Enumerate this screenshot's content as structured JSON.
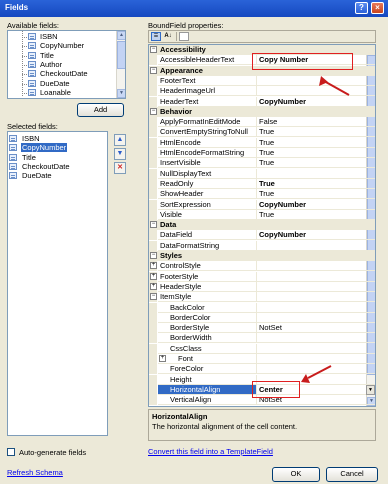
{
  "window": {
    "title": "Fields",
    "help": "?",
    "close": "×"
  },
  "available": {
    "label": "Available fields:",
    "items": [
      "ISBN",
      "CopyNumber",
      "Title",
      "Author",
      "CheckoutDate",
      "DueDate",
      "Loanable"
    ],
    "add_label": "Add"
  },
  "selected": {
    "label": "Selected fields:",
    "items": [
      "ISBN",
      "CopyNumber",
      "Title",
      "CheckoutDate",
      "DueDate"
    ],
    "selected_index": 1,
    "up": "▲",
    "down": "▼",
    "delete": "✕"
  },
  "properties": {
    "label": "BoundField properties:",
    "rows": [
      {
        "type": "cat",
        "name": "Accessibility",
        "pm": "−"
      },
      {
        "type": "prop",
        "name": "AccessibleHeaderText",
        "value": "Copy Number",
        "bold": true
      },
      {
        "type": "cat",
        "name": "Appearance",
        "pm": "−"
      },
      {
        "type": "prop",
        "name": "FooterText",
        "value": ""
      },
      {
        "type": "prop",
        "name": "HeaderImageUrl",
        "value": ""
      },
      {
        "type": "prop",
        "name": "HeaderText",
        "value": "CopyNumber",
        "bold": true
      },
      {
        "type": "cat",
        "name": "Behavior",
        "pm": "−"
      },
      {
        "type": "prop",
        "name": "ApplyFormatInEditMode",
        "value": "False"
      },
      {
        "type": "prop",
        "name": "ConvertEmptyStringToNull",
        "value": "True"
      },
      {
        "type": "prop",
        "name": "HtmlEncode",
        "value": "True"
      },
      {
        "type": "prop",
        "name": "HtmlEncodeFormatString",
        "value": "True"
      },
      {
        "type": "prop",
        "name": "InsertVisible",
        "value": "True"
      },
      {
        "type": "prop",
        "name": "NullDisplayText",
        "value": ""
      },
      {
        "type": "prop",
        "name": "ReadOnly",
        "value": "True",
        "bold": true
      },
      {
        "type": "prop",
        "name": "ShowHeader",
        "value": "True"
      },
      {
        "type": "prop",
        "name": "SortExpression",
        "value": "CopyNumber",
        "bold": true
      },
      {
        "type": "prop",
        "name": "Visible",
        "value": "True"
      },
      {
        "type": "cat",
        "name": "Data",
        "pm": "−"
      },
      {
        "type": "prop",
        "name": "DataField",
        "value": "CopyNumber",
        "bold": true
      },
      {
        "type": "prop",
        "name": "DataFormatString",
        "value": ""
      },
      {
        "type": "cat",
        "name": "Styles",
        "pm": "−"
      },
      {
        "type": "group",
        "name": "ControlStyle",
        "pm": "+"
      },
      {
        "type": "group",
        "name": "FooterStyle",
        "pm": "+"
      },
      {
        "type": "group",
        "name": "HeaderStyle",
        "pm": "+"
      },
      {
        "type": "group",
        "name": "ItemStyle",
        "pm": "−"
      },
      {
        "type": "sub",
        "name": "BackColor",
        "value": ""
      },
      {
        "type": "sub",
        "name": "BorderColor",
        "value": ""
      },
      {
        "type": "sub",
        "name": "BorderStyle",
        "value": "NotSet"
      },
      {
        "type": "sub",
        "name": "BorderWidth",
        "value": ""
      },
      {
        "type": "sub",
        "name": "CssClass",
        "value": ""
      },
      {
        "type": "subgroup",
        "name": "Font",
        "pm": "+"
      },
      {
        "type": "sub",
        "name": "ForeColor",
        "value": ""
      },
      {
        "type": "sub",
        "name": "Height",
        "value": ""
      },
      {
        "type": "sub",
        "name": "HorizontalAlign",
        "value": "Center",
        "bold": true,
        "selected": true,
        "dropdown": true
      },
      {
        "type": "sub",
        "name": "VerticalAlign",
        "value": "NotSet"
      }
    ],
    "description_title": "HorizontalAlign",
    "description_text": "The horizontal alignment of the cell content."
  },
  "autogen_label": "Auto-generate fields",
  "convert_link": "Convert this field into a TemplateField",
  "refresh_link": "Refresh Schema",
  "ok_label": "OK",
  "cancel_label": "Cancel",
  "dropdown_glyph": "▼",
  "colors": {
    "accent_red": "#e02020",
    "selection": "#316ac5"
  }
}
